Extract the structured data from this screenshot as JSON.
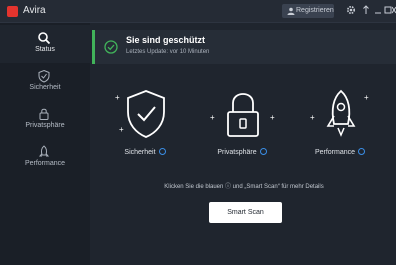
{
  "app": {
    "name": "Avira"
  },
  "titlebar": {
    "register_label": "Registrieren",
    "icons": [
      "gear-icon",
      "notifications-icon",
      "minimize-icon",
      "maximize-icon",
      "close-icon"
    ]
  },
  "sidebar": {
    "items": [
      {
        "label": "Status",
        "icon": "search-icon",
        "active": true
      },
      {
        "label": "Sicherheit",
        "icon": "security-icon",
        "active": false
      },
      {
        "label": "Privatsphäre",
        "icon": "privacy-icon",
        "active": false
      },
      {
        "label": "Performance",
        "icon": "performance-icon",
        "active": false
      }
    ]
  },
  "status": {
    "title": "Sie sind geschützt",
    "subtitle": "Letztes Update: vor 10 Minuten",
    "accent": "#41b35a"
  },
  "features": [
    {
      "label": "Sicherheit",
      "icon": "shield-check-icon"
    },
    {
      "label": "Privatsphäre",
      "icon": "padlock-icon"
    },
    {
      "label": "Performance",
      "icon": "rocket-icon"
    }
  ],
  "hint": "Klicken Sie die blauen ⓘ und „Smart Scan“ für mehr Details",
  "scan_button": "Smart Scan",
  "colors": {
    "background": "#1f252e",
    "sidebar": "#1a1f27",
    "brand": "#e4342e",
    "info": "#3a8ee6"
  }
}
